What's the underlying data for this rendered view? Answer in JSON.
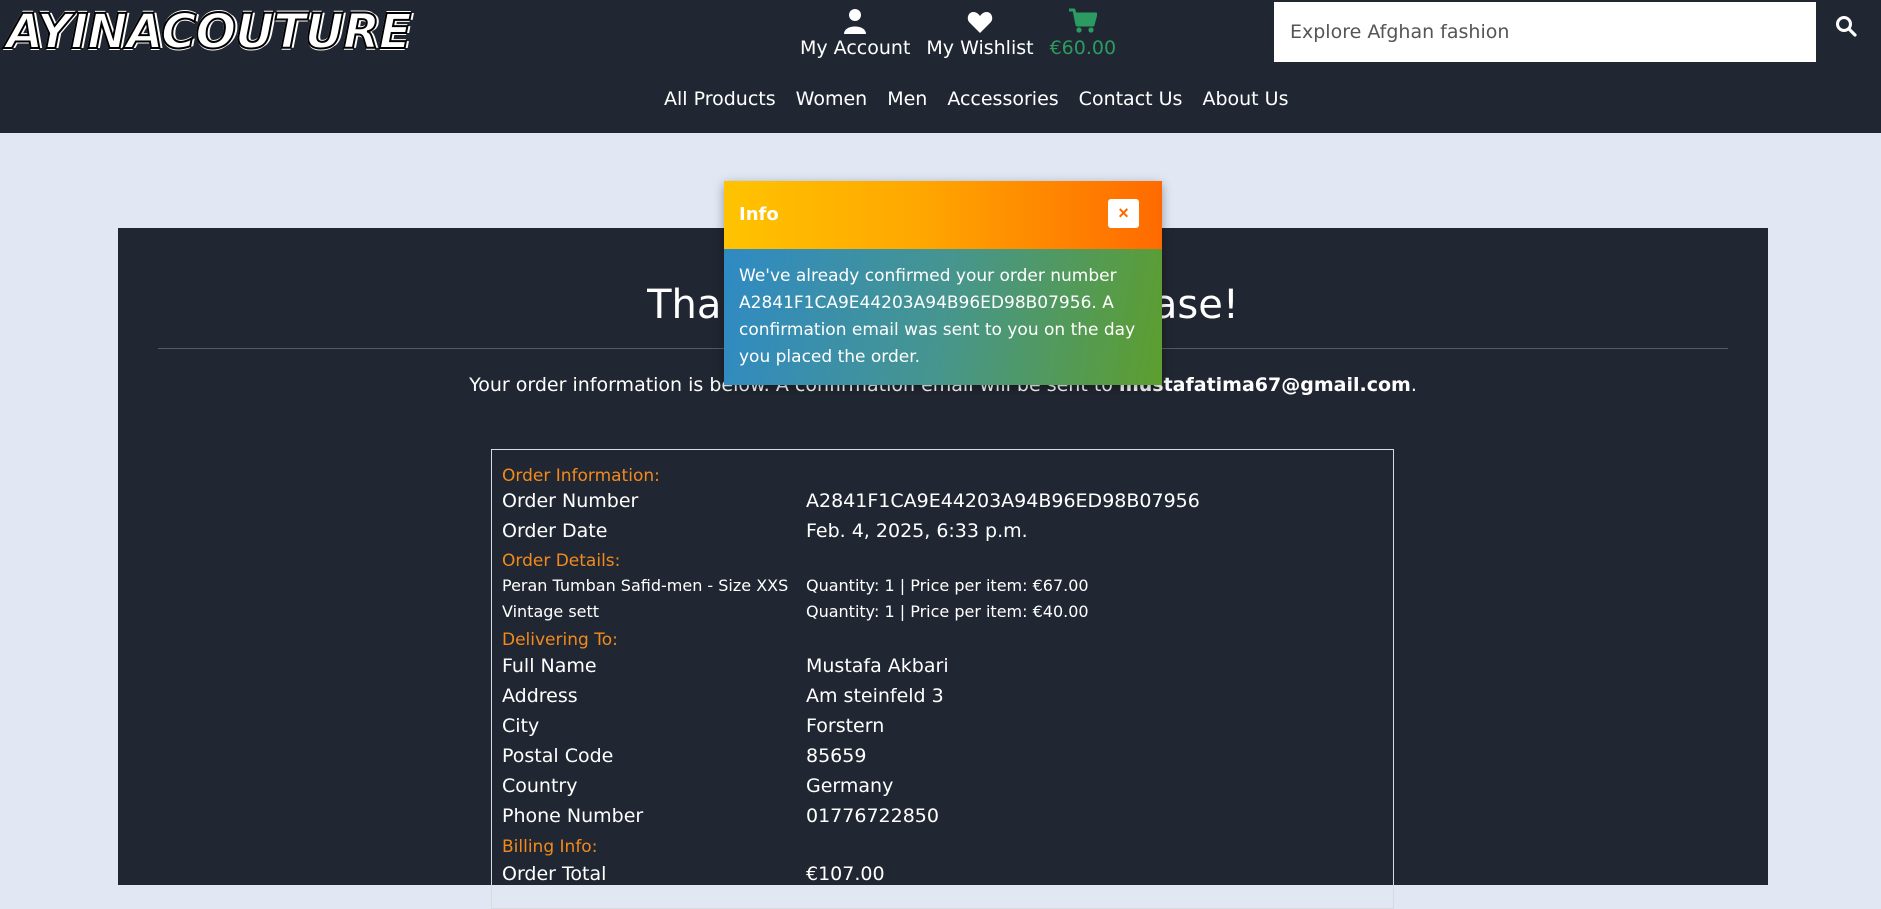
{
  "header": {
    "logo_text": "AYINACOUTURE",
    "account_label": "My Account",
    "wishlist_label": "My Wishlist",
    "cart_total": "€60.00",
    "search_placeholder": "Explore Afghan fashion",
    "nav": [
      "All Products",
      "Women",
      "Men",
      "Accessories",
      "Contact Us",
      "About Us"
    ]
  },
  "toast": {
    "title": "Info",
    "close_symbol": "×",
    "message": "We've already confirmed your order number A2841F1CA9E44203A94B96ED98B07956. A confirmation email was sent to you on the day you placed the order."
  },
  "page": {
    "title": "Thank you for your purchase!",
    "info_prefix": "Your order information is below. A confirmation email will be sent to ",
    "email": "mustafatima67@gmail.com",
    "info_suffix": "."
  },
  "order": {
    "order_info_heading": "Order Information:",
    "order_number_label": "Order Number",
    "order_number": "A2841F1CA9E44203A94B96ED98B07956",
    "order_date_label": "Order Date",
    "order_date": "Feb. 4, 2025, 6:33 p.m.",
    "details_heading": "Order Details:",
    "items": [
      {
        "name": "Peran Tumban Safid-men - Size XXS",
        "detail": "Quantity: 1 | Price per item: €67.00"
      },
      {
        "name": "Vintage sett",
        "detail": "Quantity: 1 | Price per item: €40.00"
      }
    ],
    "delivering_heading": "Delivering To:",
    "full_name_label": "Full Name",
    "full_name": "Mustafa Akbari",
    "address_label": "Address",
    "address": "Am steinfeld 3",
    "city_label": "City",
    "city": "Forstern",
    "postal_label": "Postal Code",
    "postal": "85659",
    "country_label": "Country",
    "country": "Germany",
    "phone_label": "Phone Number",
    "phone": "01776722850",
    "billing_heading": "Billing Info:",
    "order_total_label": "Order Total",
    "order_total": "€107.00"
  },
  "colors": {
    "header_bg": "#212732",
    "page_bg": "#e1e8f4",
    "accent_orange": "#f28a1c",
    "cart_green": "#2b9b61"
  }
}
